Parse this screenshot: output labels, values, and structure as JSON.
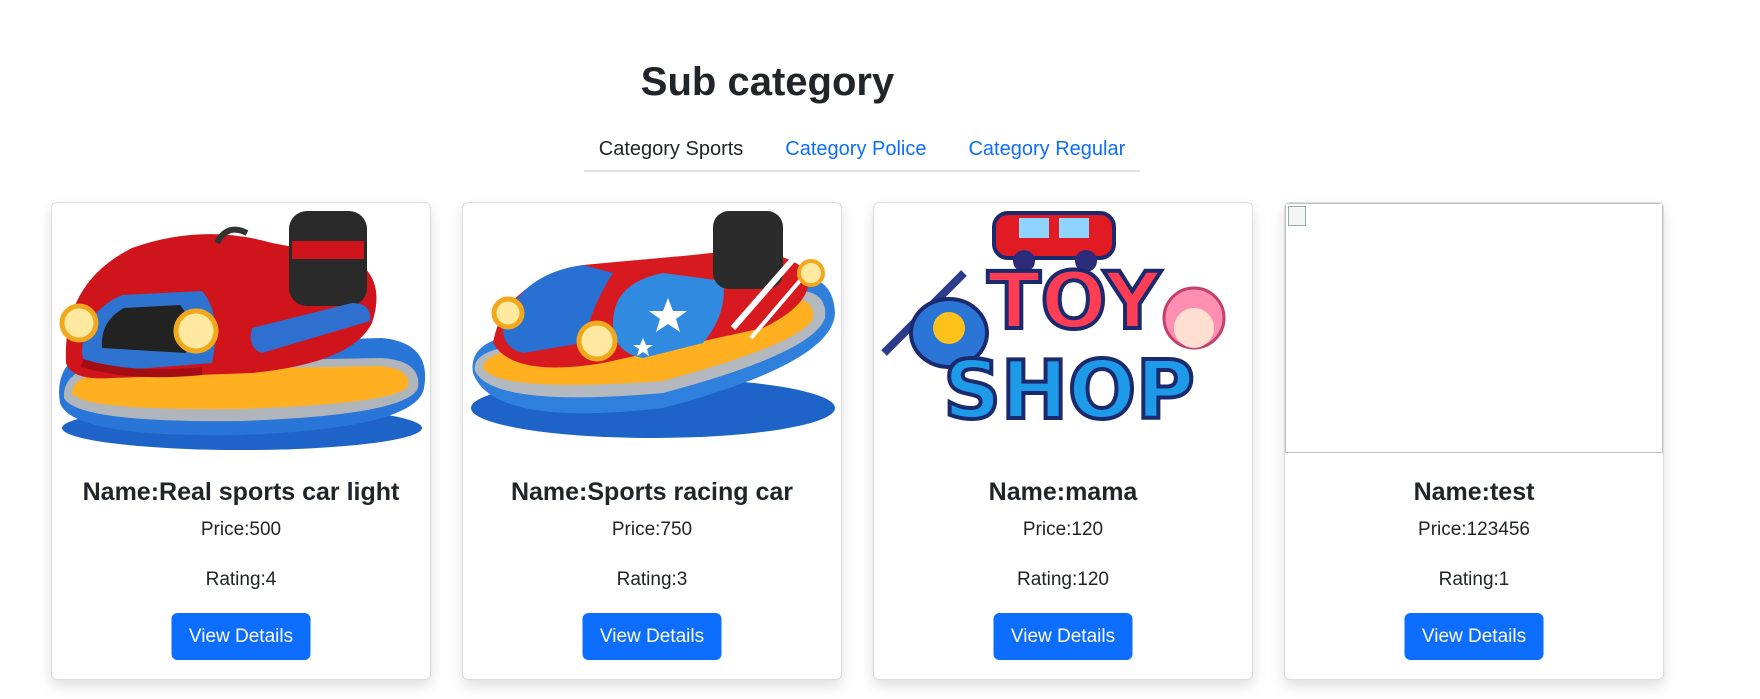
{
  "page": {
    "title": "Sub category"
  },
  "tabs": [
    {
      "label": "Category Sports",
      "active": true
    },
    {
      "label": "Category Police",
      "active": false
    },
    {
      "label": "Category Regular",
      "active": false
    }
  ],
  "products": [
    {
      "name": "Name:Real sports car light",
      "price": "Price:500",
      "rating": "Rating:4",
      "button": "View Details",
      "image": "red-bumper-car"
    },
    {
      "name": "Name:Sports racing car",
      "price": "Price:750",
      "rating": "Rating:3",
      "button": "View Details",
      "image": "blue-red-bumper-car"
    },
    {
      "name": "Name:mama",
      "price": "Price:120",
      "rating": "Rating:120",
      "button": "View Details",
      "image": "toy-shop-logo"
    },
    {
      "name": "Name:test",
      "price": "Price:123456",
      "rating": "Rating:1",
      "button": "View Details",
      "image": "broken-image"
    }
  ],
  "colors": {
    "accent": "#0d6efd",
    "text": "#212529",
    "divider": "#dee2e6"
  },
  "image_text": {
    "toy_shop_logo": [
      "TOY",
      "SHOP"
    ]
  }
}
